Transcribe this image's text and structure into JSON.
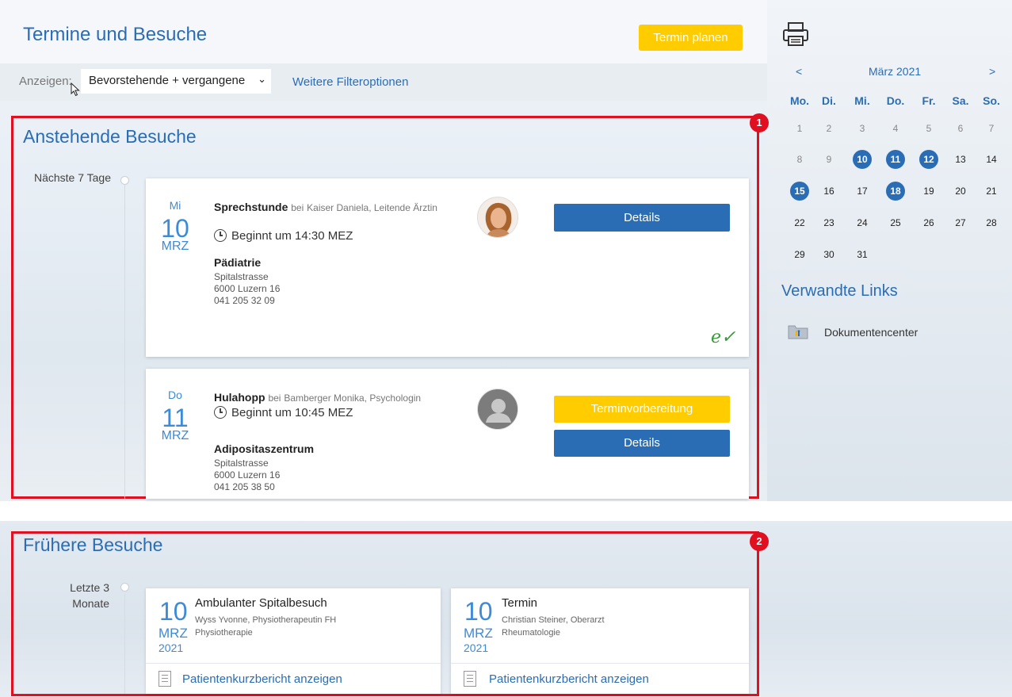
{
  "header": {
    "title": "Termine und Besuche",
    "plan_button": "Termin planen"
  },
  "filter": {
    "label": "Anzeigen:",
    "selected": "Bevorstehende + vergangene",
    "more_options": "Weitere Filteroptionen"
  },
  "upcoming": {
    "title": "Anstehende Besuche",
    "badge": "1",
    "group_label": "Nächste 7 Tage",
    "appointments": [
      {
        "weekday": "Mi",
        "day": "10",
        "month": "MRZ",
        "type": "Sprechstunde",
        "by_prefix": "bei",
        "doctor": "Kaiser Daniela, Leitende Ärztin",
        "time": "Beginnt um 14:30 MEZ",
        "department": "Pädiatrie",
        "address": [
          "Spitalstrasse",
          "6000 Luzern 16",
          "041 205 32 09"
        ],
        "details_button": "Details"
      },
      {
        "weekday": "Do",
        "day": "11",
        "month": "MRZ",
        "type": "Hulahopp",
        "by_prefix": "bei",
        "doctor": "Bamberger Monika, Psychologin",
        "time": "Beginnt um 10:45 MEZ",
        "department": "Adipositaszentrum",
        "address": [
          "Spitalstrasse",
          "6000 Luzern 16",
          "041 205 38 50"
        ],
        "prep_button": "Terminvorbereitung",
        "details_button": "Details"
      }
    ]
  },
  "past": {
    "title": "Frühere Besuche",
    "badge": "2",
    "group_label_1": "Letzte 3",
    "group_label_2": "Monate",
    "visits": [
      {
        "day": "10",
        "month": "MRZ",
        "year": "2021",
        "title": "Ambulanter Spitalbesuch",
        "doctor": "Wyss Yvonne, Physiotherapeutin FH",
        "department": "Physiotherapie",
        "report_link": "Patientenkurzbericht anzeigen"
      },
      {
        "day": "10",
        "month": "MRZ",
        "year": "2021",
        "title": "Termin",
        "doctor": "Christian Steiner, Oberarzt",
        "department": "Rheumatologie",
        "report_link": "Patientenkurzbericht anzeigen"
      }
    ]
  },
  "calendar": {
    "prev": "<",
    "next": ">",
    "month_label": "März 2021",
    "weekdays": [
      "Mo.",
      "Di.",
      "Mi.",
      "Do.",
      "Fr.",
      "Sa.",
      "So."
    ],
    "weeks": [
      [
        "1",
        "2",
        "3",
        "4",
        "5",
        "6",
        "7"
      ],
      [
        "8",
        "9",
        "10",
        "11",
        "12",
        "13",
        "14"
      ],
      [
        "15",
        "16",
        "17",
        "18",
        "19",
        "20",
        "21"
      ],
      [
        "22",
        "23",
        "24",
        "25",
        "26",
        "27",
        "28"
      ],
      [
        "29",
        "30",
        "31",
        "",
        "",
        "",
        ""
      ]
    ],
    "marked_days": [
      "10",
      "11",
      "12",
      "15",
      "18"
    ],
    "muted_days": [
      "1",
      "2",
      "3",
      "4",
      "5",
      "6",
      "7",
      "8",
      "9"
    ]
  },
  "related": {
    "title": "Verwandte Links",
    "links": [
      "Dokumentencenter"
    ]
  },
  "colors": {
    "brand_blue": "#2a6db5",
    "accent_yellow": "#ffcc00",
    "highlight_red": "#e01020"
  }
}
